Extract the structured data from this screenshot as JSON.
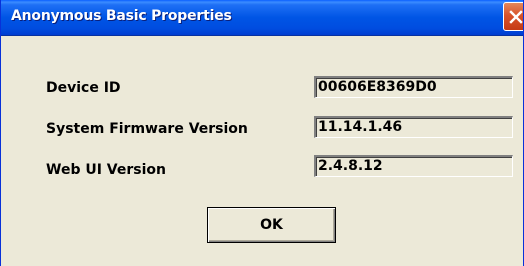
{
  "window": {
    "title": "Anonymous Basic Properties"
  },
  "properties": [
    {
      "label": "Device ID",
      "value": "00606E8369D0"
    },
    {
      "label": "System Firmware Version",
      "value": "11.14.1.46"
    },
    {
      "label": "Web UI Version",
      "value": "2.4.8.12"
    }
  ],
  "buttons": {
    "ok_label": "OK"
  },
  "icons": {
    "close": "close-icon"
  },
  "colors": {
    "titlebar": "#0055e5",
    "dialog_bg": "#ece9d8",
    "close_button": "#d9532a"
  }
}
